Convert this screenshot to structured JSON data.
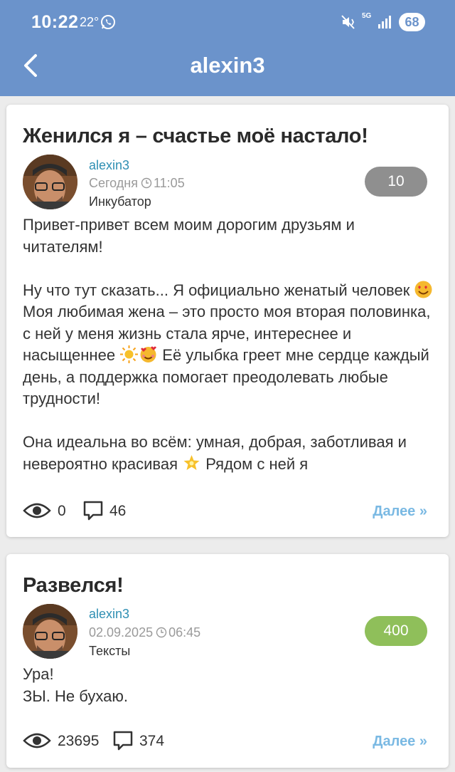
{
  "status_bar": {
    "time": "10:22",
    "temperature": "22°",
    "network": "5G",
    "battery": "68"
  },
  "header": {
    "title": "alexin3",
    "back_icon": "chevron-left-icon"
  },
  "posts": [
    {
      "title": "Женился я – счастье моё настало!",
      "author": "alexin3",
      "date": "Сегодня",
      "time": "11:05",
      "category": "Инкубатор",
      "rating": "10",
      "rating_color": "#8f8f8f",
      "body_1": "Привет-привет всем моим дорогим друзьям и читателям!\n\nНу что тут сказать... Я официально женатый человек ",
      "body_2": " Моя любимая жена – это просто моя вторая половинка, с ней у меня жизнь стала ярче, интереснее и насыщеннее ",
      "body_3": " Её улыбка греет мне сердце каждый день, а поддержка помогает преодолевать любые трудности!\n\nОна идеальна во всём: умная, добрая, заботливая и невероятно красивая ",
      "body_4": " Рядом с ней я",
      "views": "0",
      "comments": "46",
      "more": "Далее »"
    },
    {
      "title": "Развелся!",
      "author": "alexin3",
      "date": "02.09.2025",
      "time": "06:45",
      "category": "Тексты",
      "rating": "400",
      "rating_color": "#8fbf5a",
      "body": "Ура!\nЗЫ. Не бухаю.",
      "views": "23695",
      "comments": "374",
      "more": "Далее »"
    }
  ],
  "colors": {
    "header_bg": "#6b93cb",
    "link": "#2f8fb3",
    "more_link": "#7ab9e3"
  }
}
